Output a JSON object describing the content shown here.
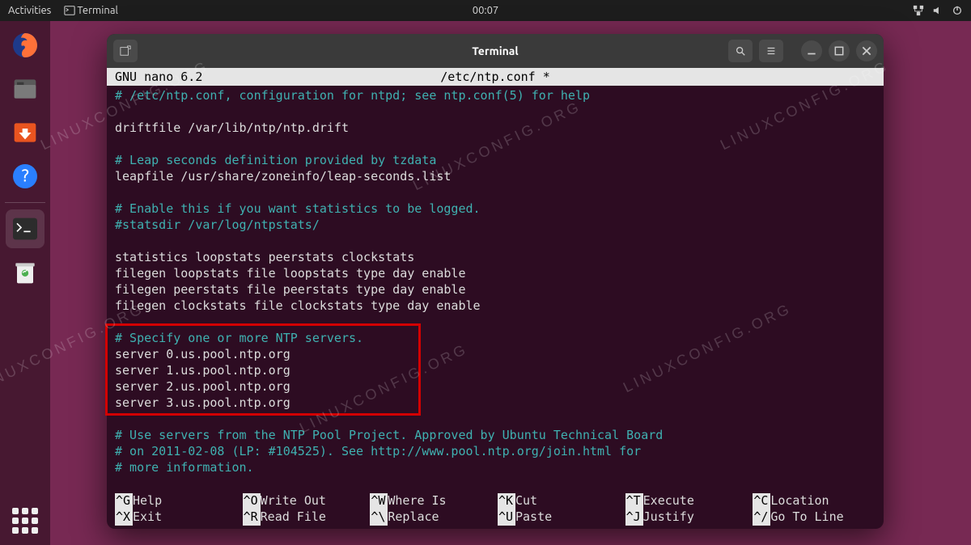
{
  "topbar": {
    "activities": "Activities",
    "app_label": "Terminal",
    "clock": "00:07"
  },
  "window": {
    "title": "Terminal"
  },
  "nano": {
    "header_left": "  GNU nano 6.2",
    "header_file": "/etc/ntp.conf *",
    "lines": [
      {
        "cls": "comment",
        "text": "# /etc/ntp.conf, configuration for ntpd; see ntp.conf(5) for help"
      },
      {
        "cls": "",
        "text": ""
      },
      {
        "cls": "",
        "text": "driftfile /var/lib/ntp/ntp.drift"
      },
      {
        "cls": "",
        "text": ""
      },
      {
        "cls": "comment",
        "text": "# Leap seconds definition provided by tzdata"
      },
      {
        "cls": "",
        "text": "leapfile /usr/share/zoneinfo/leap-seconds.list"
      },
      {
        "cls": "",
        "text": ""
      },
      {
        "cls": "comment",
        "text": "# Enable this if you want statistics to be logged."
      },
      {
        "cls": "comment",
        "text": "#statsdir /var/log/ntpstats/"
      },
      {
        "cls": "",
        "text": ""
      },
      {
        "cls": "",
        "text": "statistics loopstats peerstats clockstats"
      },
      {
        "cls": "",
        "text": "filegen loopstats file loopstats type day enable"
      },
      {
        "cls": "",
        "text": "filegen peerstats file peerstats type day enable"
      },
      {
        "cls": "",
        "text": "filegen clockstats file clockstats type day enable"
      },
      {
        "cls": "",
        "text": ""
      },
      {
        "cls": "comment",
        "text": "# Specify one or more NTP servers."
      },
      {
        "cls": "",
        "text": "server 0.us.pool.ntp.org"
      },
      {
        "cls": "",
        "text": "server 1.us.pool.ntp.org"
      },
      {
        "cls": "",
        "text": "server 2.us.pool.ntp.org"
      },
      {
        "cls": "",
        "text": "server 3.us.pool.ntp.org"
      },
      {
        "cls": "",
        "text": ""
      },
      {
        "cls": "comment",
        "text": "# Use servers from the NTP Pool Project. Approved by Ubuntu Technical Board"
      },
      {
        "cls": "comment",
        "text": "# on 2011-02-08 (LP: #104525). See http://www.pool.ntp.org/join.html for"
      },
      {
        "cls": "comment",
        "text": "# more information."
      }
    ],
    "shortcuts": [
      {
        "key": "^G",
        "label": "Help"
      },
      {
        "key": "^O",
        "label": "Write Out"
      },
      {
        "key": "^W",
        "label": "Where Is"
      },
      {
        "key": "^K",
        "label": "Cut"
      },
      {
        "key": "^T",
        "label": "Execute"
      },
      {
        "key": "^C",
        "label": "Location"
      },
      {
        "key": "^X",
        "label": "Exit"
      },
      {
        "key": "^R",
        "label": "Read File"
      },
      {
        "key": "^\\",
        "label": "Replace"
      },
      {
        "key": "^U",
        "label": "Paste"
      },
      {
        "key": "^J",
        "label": "Justify"
      },
      {
        "key": "^/",
        "label": "Go To Line"
      }
    ]
  },
  "watermark": "LINUXCONFIG.ORG"
}
